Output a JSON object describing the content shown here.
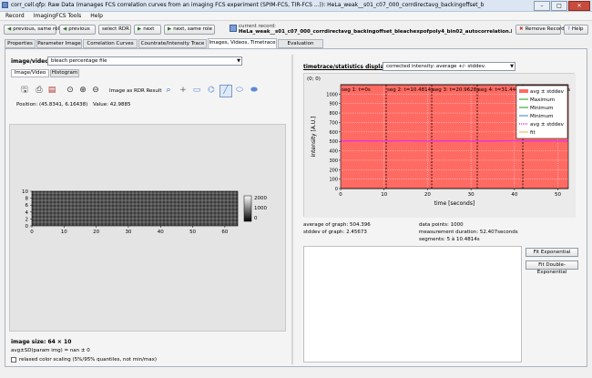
{
  "window": {
    "title": "corr_cell.qfp: Raw Data (manages FCS correlation curves from an imaging FCS experiment (SPIM-FCS, TIR-FCS ...)): HeLa_weak__s01_c07_000_corrdirectavg_backingoffset_bleachexpofpoly4_bin02_autocorrelation.bin - ACF"
  },
  "menu": [
    "Record",
    "ImagingFCS Tools",
    "Help"
  ],
  "toolbar": {
    "prev_same_role": "previous, same role",
    "previous": "previous",
    "select_rdr": "select RDR",
    "next": "next",
    "next_same_role": "next, same role",
    "current_record_label": "current record:",
    "current_record_value": "HeLa_weak__s01_c07_000_corrdirectavg_backingoffset_bleachexpofpoly4_bin02_autocorrelation.bin - ACF",
    "remove_record": "Remove Record",
    "help": "Help"
  },
  "tabs": [
    "Properties",
    "Parameter Image",
    "Correlation Curves",
    "Countrate/Intensity Trace",
    "Images, Videos, Timetrace",
    "Evaluation Results"
  ],
  "left": {
    "image_video_label": "image/video:",
    "image_video_value": "bleach percentage file",
    "subtabs": [
      "Image/Video",
      "Histogram"
    ],
    "image_as_rdr": "Image as RDR Result",
    "position": "Position: (45.8341, 6.16438)",
    "value": "Value: 42.9885",
    "image_size": "image size: 64 × 10",
    "avg_sd": "avg±SD(param img) = nan ± 0",
    "relaxed_scaling": "relaxed color scaling (5%/95% quantiles, not min/max)",
    "x_ticks": [
      "0",
      "10",
      "20",
      "30",
      "40",
      "50",
      "60"
    ],
    "y_ticks": [
      "0",
      "2",
      "4",
      "6",
      "8",
      "10"
    ],
    "colorbar_ticks": [
      "2000",
      "1000",
      "0"
    ]
  },
  "right": {
    "display_label": "timetrace/statistics display:",
    "display_value": "corrected intensity: average +/- stddev.",
    "plot": {
      "corner_label": "(0; 0)",
      "xlabel": "time [seconds]",
      "ylabel": "intensity [A.U.]",
      "x_ticks": [
        "0",
        "10",
        "20",
        "30",
        "40",
        "50"
      ],
      "y_ticks": [
        "1000",
        "900",
        "800",
        "700",
        "600",
        "500",
        "400",
        "300",
        "200",
        "100",
        "0"
      ],
      "segments": [
        "seg 1: t=0s",
        "seg 2: t=10.4814s",
        "seg 3: t=20.9628s",
        "seg 4: t=31.4442s",
        "seg 5: t=41.9256s"
      ],
      "legend": [
        "avg ± stddev",
        "Maximum",
        "Minimum",
        "Minimum",
        "avg ± stddev",
        "fit"
      ]
    },
    "stats": {
      "avg": "average of graph: 504.396",
      "stddev": "stddev of graph: 2.45673",
      "points": "data points: 1000",
      "duration": "measurement duration: 52.407seconds",
      "segments": "segments: 5 à 10.4814s"
    },
    "fit_exponential": "Fit Exponential",
    "fit_double_exponential": "Fit Double-Exponential"
  },
  "chart_data": {
    "type": "line",
    "xlabel": "time [seconds]",
    "ylabel": "intensity [A.U.]",
    "xlim": [
      0,
      52.4
    ],
    "ylim": [
      0,
      1100
    ],
    "grid": true,
    "legend_position": "top-right",
    "series": [
      {
        "name": "avg ± stddev",
        "x": [
          0,
          5,
          10,
          15,
          20,
          25,
          30,
          35,
          40,
          45,
          50,
          52.4
        ],
        "values": [
          504,
          505,
          503,
          506,
          504,
          505,
          503,
          504,
          506,
          504,
          505,
          504
        ],
        "color": "#e63ad1"
      },
      {
        "name": "Maximum",
        "x": [
          0,
          52.4
        ],
        "values": [
          1100,
          1100
        ],
        "color": "#ff5555"
      },
      {
        "name": "Minimum",
        "x": [
          0,
          52.4
        ],
        "values": [
          0,
          0
        ],
        "color": "#ff5555"
      }
    ],
    "segment_boundaries": [
      10.4814,
      20.9628,
      31.4442,
      41.9256
    ]
  }
}
